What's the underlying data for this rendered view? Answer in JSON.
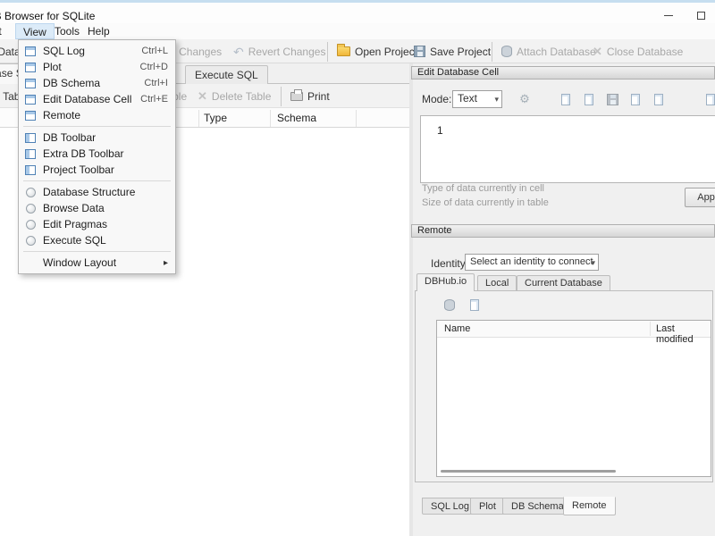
{
  "titlebar": {
    "title": "DB Browser for SQLite"
  },
  "menubar": {
    "items": [
      {
        "label": "Edit"
      },
      {
        "label": "View"
      },
      {
        "label": "Tools"
      },
      {
        "label": "Help"
      }
    ]
  },
  "toolbar": {
    "buttons": [
      {
        "label": "New Database"
      },
      {
        "label": "Write Changes"
      },
      {
        "label": "Revert Changes"
      },
      {
        "label": "Open Project"
      },
      {
        "label": "Save Project"
      },
      {
        "label": "Attach Database"
      },
      {
        "label": "Close Database"
      }
    ]
  },
  "main_tabs": {
    "items": [
      {
        "label": "Database Structure"
      },
      {
        "label": "Execute SQL"
      }
    ]
  },
  "structure_toolbar": {
    "buttons": [
      {
        "label": "Create Table"
      },
      {
        "label": "Modify Table"
      },
      {
        "label": "Delete Table"
      },
      {
        "label": "Print"
      }
    ]
  },
  "table": {
    "columns": [
      {
        "label": "Type"
      },
      {
        "label": "Schema"
      }
    ]
  },
  "view_menu": {
    "items": [
      {
        "label": "SQL Log",
        "shortcut": "Ctrl+L"
      },
      {
        "label": "Plot",
        "shortcut": "Ctrl+D"
      },
      {
        "label": "DB Schema",
        "shortcut": "Ctrl+I"
      },
      {
        "label": "Edit Database Cell",
        "shortcut": "Ctrl+E"
      },
      {
        "label": "Remote"
      },
      {
        "label": "DB Toolbar"
      },
      {
        "label": "Extra DB Toolbar"
      },
      {
        "label": "Project Toolbar"
      },
      {
        "label": "Database Structure"
      },
      {
        "label": "Browse Data"
      },
      {
        "label": "Edit Pragmas"
      },
      {
        "label": "Execute SQL"
      },
      {
        "label": "Window Layout",
        "arrow": "▸"
      }
    ]
  },
  "edit_cell_panel": {
    "title": "Edit Database Cell",
    "mode_label": "Mode:",
    "mode_value": "Text",
    "mode_arrow": "▾",
    "cell_content": "1",
    "info_line1": "Type of data currently in cell",
    "info_line2": "Size of data currently in table",
    "apply_label": "Apply"
  },
  "remote_panel": {
    "title": "Remote",
    "identity_label": "Identity",
    "identity_value": "Select an identity to connect",
    "identity_arrow": "▾",
    "tabs": [
      {
        "label": "DBHub.io"
      },
      {
        "label": "Local"
      },
      {
        "label": "Current Database"
      }
    ],
    "list_columns": [
      {
        "label": "Name"
      },
      {
        "label": "Last modified"
      }
    ]
  },
  "bottom_tabs": {
    "items": [
      {
        "label": "SQL Log"
      },
      {
        "label": "Plot"
      },
      {
        "label": "DB Schema"
      },
      {
        "label": "Remote"
      }
    ]
  },
  "colors": {
    "accent_blue": "#4f81b5",
    "folder_yellow": "#f0b63a",
    "disabled_text": "#a8a8a8"
  }
}
